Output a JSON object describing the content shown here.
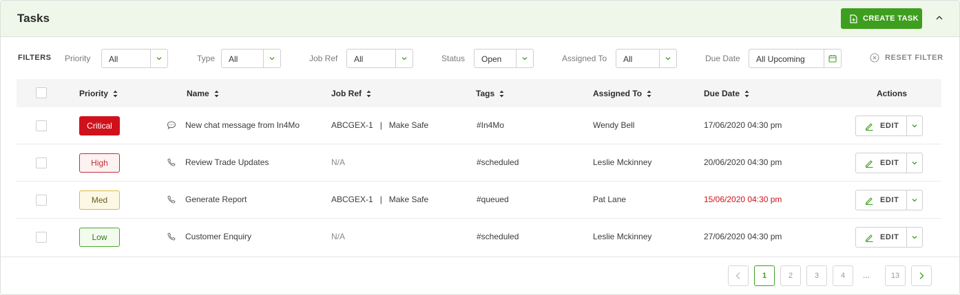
{
  "header": {
    "title": "Tasks",
    "create_label": "CREATE TASK"
  },
  "filters": {
    "label": "FILTERS",
    "priority": {
      "label": "Priority",
      "value": "All"
    },
    "type": {
      "label": "Type",
      "value": "All"
    },
    "job_ref": {
      "label": "Job Ref",
      "value": "All"
    },
    "status": {
      "label": "Status",
      "value": "Open"
    },
    "assigned_to": {
      "label": "Assigned To",
      "value": "All"
    },
    "due_date": {
      "label": "Due Date",
      "value": "All Upcoming"
    },
    "reset_label": "RESET FILTER"
  },
  "table": {
    "columns": [
      "Priority",
      "Name",
      "Job Ref",
      "Tags",
      "Assigned To",
      "Due Date",
      "Actions"
    ],
    "rows": [
      {
        "priority": "Critical",
        "icon": "chat-icon",
        "name": "New chat message from In4Mo",
        "job_ref": "ABCGEX-1   |   Make Safe",
        "tags": "#In4Mo",
        "assigned_to": "Wendy Bell",
        "due_date": "17/06/2020 04:30 pm",
        "overdue": false,
        "action": "EDIT"
      },
      {
        "priority": "High",
        "icon": "phone-icon",
        "name": "Review Trade Updates",
        "job_ref": "N/A",
        "tags": "#scheduled",
        "assigned_to": "Leslie Mckinney",
        "due_date": "20/06/2020 04:30 pm",
        "overdue": false,
        "action": "EDIT"
      },
      {
        "priority": "Med",
        "icon": "phone-icon",
        "name": "Generate Report",
        "job_ref": "ABCGEX-1   |   Make Safe",
        "tags": "#queued",
        "assigned_to": "Pat Lane",
        "due_date": "15/06/2020 04:30 pm",
        "overdue": true,
        "action": "EDIT"
      },
      {
        "priority": "Low",
        "icon": "phone-icon",
        "name": "Customer Enquiry",
        "job_ref": "N/A",
        "tags": "#scheduled",
        "assigned_to": "Leslie Mckinney",
        "due_date": "27/06/2020 04:30 pm",
        "overdue": false,
        "action": "EDIT"
      }
    ]
  },
  "pagination": {
    "pages": [
      "1",
      "2",
      "3",
      "4"
    ],
    "ellipsis": "...",
    "last": "13",
    "current": "1"
  },
  "colors": {
    "accent": "#3e9e1e",
    "header_bg": "#eef7ea",
    "critical": "#d0111b",
    "high_border": "#c0303a",
    "med_border": "#e2b53b",
    "low_border": "#49a82b",
    "overdue": "#d0111b"
  }
}
